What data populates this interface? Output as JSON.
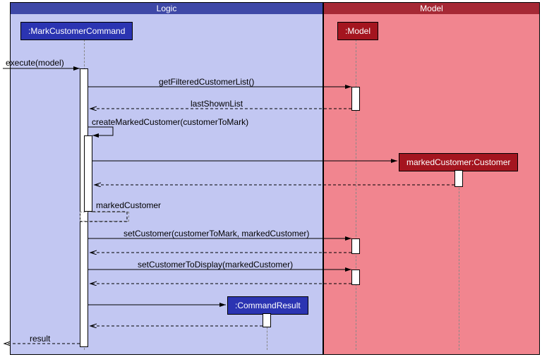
{
  "regions": {
    "logic": {
      "title": "Logic",
      "bg": "#C2C7F2",
      "header_bg": "#3E48A7"
    },
    "model": {
      "title": "Model",
      "bg": "#F1858F",
      "header_bg": "#A62935"
    }
  },
  "participants": {
    "markCmd": {
      "label": ":MarkCustomerCommand",
      "bg": "#2B34B2"
    },
    "model": {
      "label": ":Model",
      "bg": "#A4151F"
    },
    "cmdResult": {
      "label": ":CommandResult",
      "bg": "#2B34B2"
    },
    "markedCust": {
      "label": "markedCustomer:Customer",
      "bg": "#A4151F"
    }
  },
  "messages": {
    "execute": "execute(model)",
    "getFiltered": "getFilteredCustomerList()",
    "lastShown": "lastShownList",
    "createMarked": "createMarkedCustomer(customerToMark)",
    "markedCustomer": "markedCustomer",
    "setCustomer": "setCustomer(customerToMark, markedCustomer)",
    "setDisplay": "setCustomerToDisplay(markedCustomer)",
    "result": "result"
  },
  "chart_data": {
    "type": "sequence-diagram",
    "regions": [
      {
        "name": "Logic",
        "participants": [
          "MarkCustomerCommand",
          "CommandResult"
        ]
      },
      {
        "name": "Model",
        "participants": [
          "Model",
          "markedCustomer:Customer"
        ]
      }
    ],
    "messages": [
      {
        "from": "caller",
        "to": "MarkCustomerCommand",
        "label": "execute(model)",
        "type": "call"
      },
      {
        "from": "MarkCustomerCommand",
        "to": "Model",
        "label": "getFilteredCustomerList()",
        "type": "call"
      },
      {
        "from": "Model",
        "to": "MarkCustomerCommand",
        "label": "lastShownList",
        "type": "return"
      },
      {
        "from": "MarkCustomerCommand",
        "to": "MarkCustomerCommand",
        "label": "createMarkedCustomer(customerToMark)",
        "type": "self"
      },
      {
        "from": "MarkCustomerCommand",
        "to": "markedCustomer:Customer",
        "label": "",
        "type": "create"
      },
      {
        "from": "markedCustomer:Customer",
        "to": "MarkCustomerCommand",
        "label": "",
        "type": "return"
      },
      {
        "from": "MarkCustomerCommand(self)",
        "to": "MarkCustomerCommand",
        "label": "markedCustomer",
        "type": "return"
      },
      {
        "from": "MarkCustomerCommand",
        "to": "Model",
        "label": "setCustomer(customerToMark, markedCustomer)",
        "type": "call"
      },
      {
        "from": "Model",
        "to": "MarkCustomerCommand",
        "label": "",
        "type": "return"
      },
      {
        "from": "MarkCustomerCommand",
        "to": "Model",
        "label": "setCustomerToDisplay(markedCustomer)",
        "type": "call"
      },
      {
        "from": "Model",
        "to": "MarkCustomerCommand",
        "label": "",
        "type": "return"
      },
      {
        "from": "MarkCustomerCommand",
        "to": "CommandResult",
        "label": "",
        "type": "create"
      },
      {
        "from": "CommandResult",
        "to": "MarkCustomerCommand",
        "label": "",
        "type": "return"
      },
      {
        "from": "MarkCustomerCommand",
        "to": "caller",
        "label": "result",
        "type": "return"
      }
    ]
  }
}
